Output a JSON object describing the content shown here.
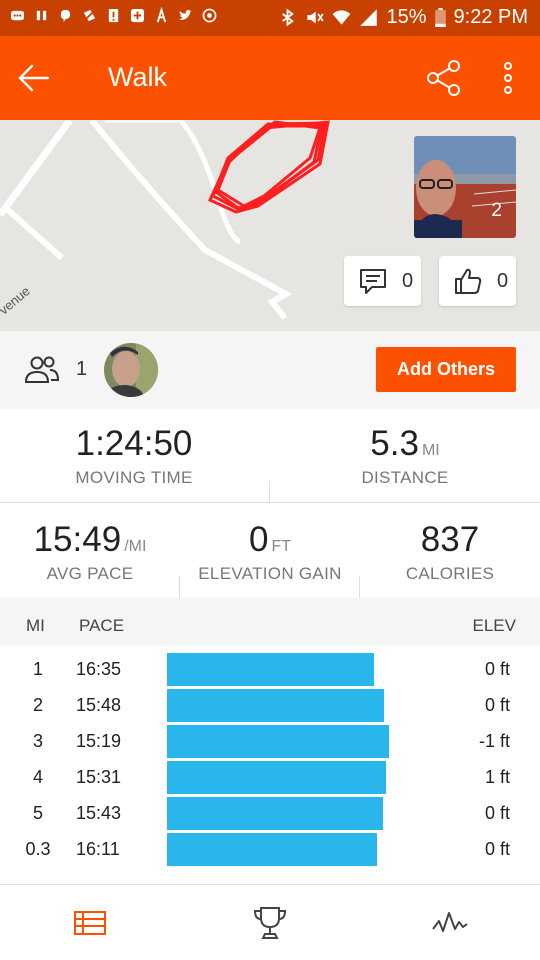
{
  "status_bar": {
    "battery_percent": "15%",
    "time": "9:22 PM",
    "icons": [
      "message-icon",
      "pause-icon",
      "hangouts-icon",
      "cancel-icon",
      "alert-icon",
      "plus-icon",
      "activity-icon",
      "twitter-icon",
      "instagram-icon",
      "bluetooth-icon",
      "mute-icon",
      "wifi-icon",
      "signal-icon",
      "battery-icon"
    ]
  },
  "app_bar": {
    "title": "Walk",
    "icons": [
      "back-arrow-icon",
      "share-icon",
      "more-vert-icon"
    ]
  },
  "map": {
    "street_label": "venue",
    "photo_count": "2",
    "comment_count": "0",
    "kudos_count": "0",
    "route_color": "#ff1f1f"
  },
  "group": {
    "athlete_count": "1",
    "add_button_label": "Add Others"
  },
  "stats": {
    "moving_time": {
      "value": "1:24:50",
      "unit": "",
      "label": "MOVING TIME"
    },
    "distance": {
      "value": "5.3",
      "unit": "MI",
      "label": "DISTANCE"
    },
    "avg_pace": {
      "value": "15:49",
      "unit": "/MI",
      "label": "AVG PACE"
    },
    "elevation_gain": {
      "value": "0",
      "unit": "FT",
      "label": "ELEVATION GAIN"
    },
    "calories": {
      "value": "837",
      "unit": "",
      "label": "CALORIES"
    }
  },
  "splits": {
    "headers": {
      "mi": "MI",
      "pace": "PACE",
      "elev": "ELEV"
    },
    "bar_color": "#29b6ec",
    "rows": [
      {
        "mi": "1",
        "pace": "16:35",
        "elev": "0 ft",
        "speed": 0.933
      },
      {
        "mi": "2",
        "pace": "15:48",
        "elev": "0 ft",
        "speed": 0.979
      },
      {
        "mi": "3",
        "pace": "15:19",
        "elev": "-1 ft",
        "speed": 1.0
      },
      {
        "mi": "4",
        "pace": "15:31",
        "elev": "1 ft",
        "speed": 0.987
      },
      {
        "mi": "5",
        "pace": "15:43",
        "elev": "0 ft",
        "speed": 0.974
      },
      {
        "mi": "0.3",
        "pace": "16:11",
        "elev": "0 ft",
        "speed": 0.946
      }
    ]
  },
  "bottom_nav": {
    "items": [
      "overview-icon",
      "trophy-icon",
      "analysis-icon"
    ],
    "active_color": "#fc5200"
  }
}
